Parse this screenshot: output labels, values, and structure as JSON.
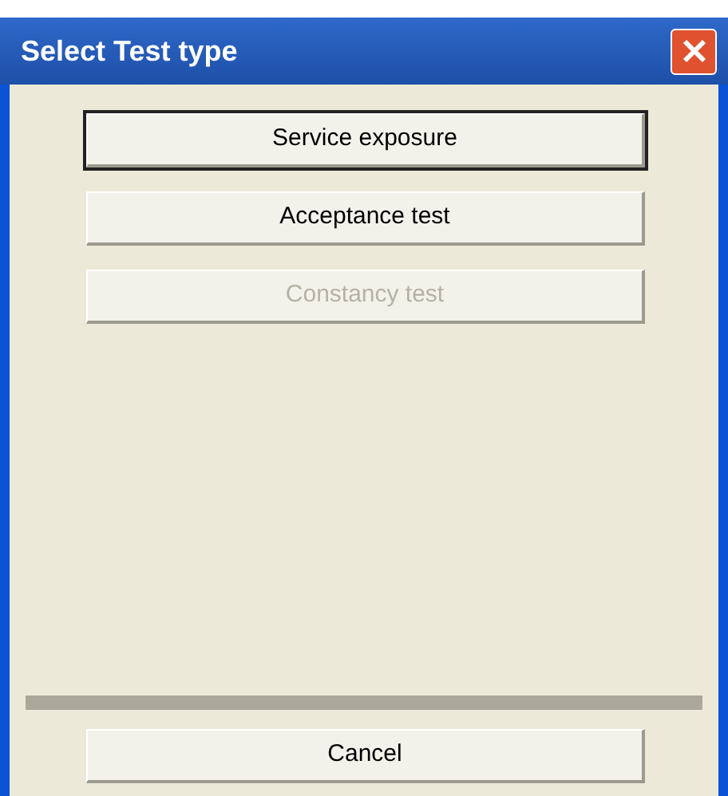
{
  "window": {
    "title": "Select Test type"
  },
  "options": [
    {
      "label": "Service exposure",
      "focused": true,
      "disabled": false
    },
    {
      "label": "Acceptance test",
      "focused": false,
      "disabled": false
    },
    {
      "label": "Constancy test",
      "focused": false,
      "disabled": true
    }
  ],
  "footer_buttons": [
    {
      "label": "Cancel",
      "focused": false,
      "disabled": false
    }
  ]
}
